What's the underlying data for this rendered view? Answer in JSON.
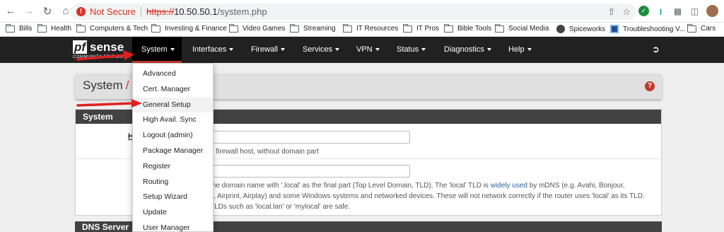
{
  "browser": {
    "not_secure_label": "Not Secure",
    "url_scheme": "https://",
    "url_host": "10.50.50.1",
    "url_path": "/system.php"
  },
  "bookmarks": [
    {
      "label": "Bills",
      "icon": "folder-icon"
    },
    {
      "label": "Health",
      "icon": "folder-icon"
    },
    {
      "label": "Computers & Tech",
      "icon": "folder-icon"
    },
    {
      "label": "Investing & Finance",
      "icon": "folder-icon"
    },
    {
      "label": "Video Games",
      "icon": "folder-icon"
    },
    {
      "label": "Streaming",
      "icon": "folder-icon"
    },
    {
      "label": "IT Resources",
      "icon": "folder-icon"
    },
    {
      "label": "IT Pros",
      "icon": "folder-icon"
    },
    {
      "label": "Bible Tools",
      "icon": "folder-icon"
    },
    {
      "label": "Social Media",
      "icon": "folder-icon"
    },
    {
      "label": "Spiceworks",
      "icon": "spiceworks-icon"
    },
    {
      "label": "Troubleshooting V...",
      "icon": "troubleshooting-icon"
    },
    {
      "label": "Cars",
      "icon": "folder-icon"
    }
  ],
  "logo": {
    "pf": "pf",
    "sense": "sense",
    "sub": "COMMUNITY EDITION"
  },
  "nav": [
    {
      "label": "System",
      "active": true
    },
    {
      "label": "Interfaces"
    },
    {
      "label": "Firewall"
    },
    {
      "label": "Services"
    },
    {
      "label": "VPN"
    },
    {
      "label": "Status"
    },
    {
      "label": "Diagnostics"
    },
    {
      "label": "Help"
    }
  ],
  "breadcrumb": {
    "title": "System",
    "slash": "/"
  },
  "system_section": {
    "heading": "System",
    "hostname_label": "H",
    "hostname_help": "e firewall host, without domain part",
    "domain_input_fragment": "n",
    "domain_help_1_a": "the domain name with '.local' as the final part (Top Level Domain, TLD), The 'local' TLD is ",
    "domain_help_1_link": "widely used",
    "domain_help_1_b": " by mDNS (e.g. Avahi, Bonjour,",
    "domain_help_2": "s, Airprint, Airplay) and some Windows systems and networked devices. These will not network correctly if the router uses 'local' as its TLD.",
    "domain_help_3": "TLDs such as 'local.lan' or 'mylocal' are safe."
  },
  "dns_section": {
    "heading": "DNS Server"
  },
  "system_menu": [
    "Advanced",
    "Cert. Manager",
    "General Setup",
    "High Avail. Sync",
    "Logout (admin)",
    "Package Manager",
    "Register",
    "Routing",
    "Setup Wizard",
    "Update",
    "User Manager"
  ],
  "colors": {
    "accent": "#c0392b",
    "navbar": "#212121",
    "section_header": "#424242",
    "annotation_arrow": "#e02020"
  }
}
